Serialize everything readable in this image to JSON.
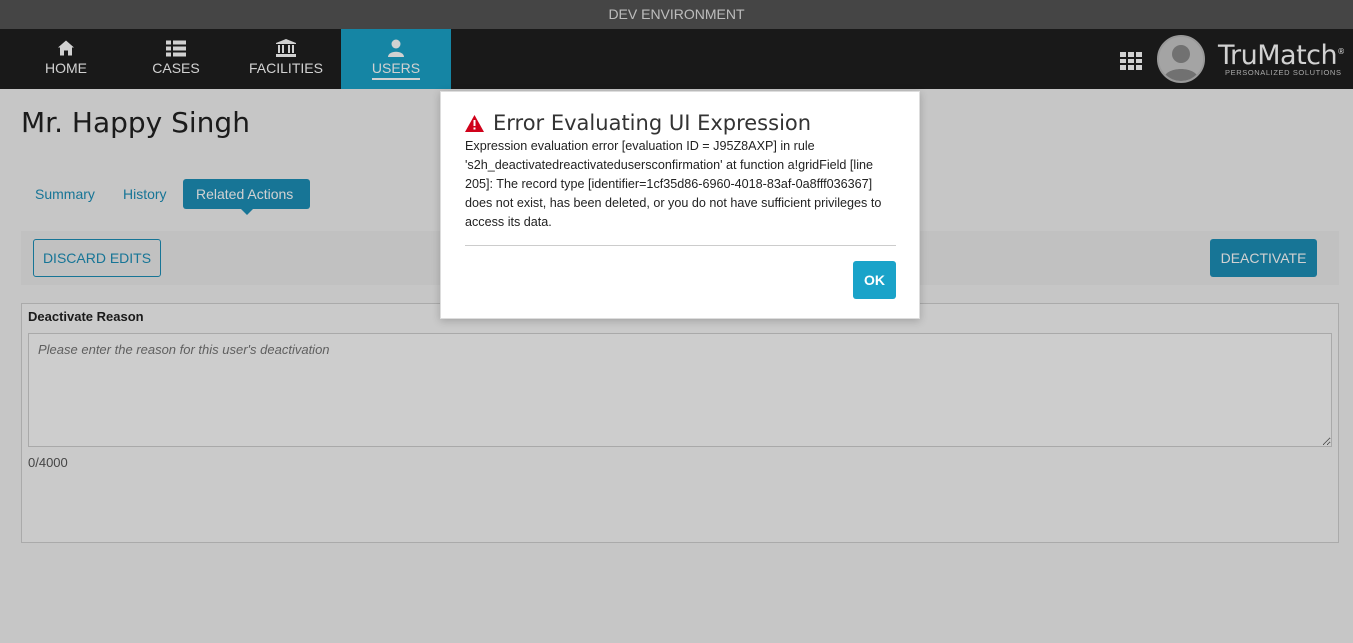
{
  "env_banner": "DEV ENVIRONMENT",
  "nav": {
    "items": [
      {
        "label": "HOME",
        "icon": "home-icon"
      },
      {
        "label": "CASES",
        "icon": "list-icon"
      },
      {
        "label": "FACILITIES",
        "icon": "bank-icon"
      },
      {
        "label": "USERS",
        "icon": "user-icon",
        "active": true
      }
    ],
    "brand_name": "TruMatch",
    "brand_reg": "®",
    "brand_tagline": "PERSONALIZED SOLUTIONS"
  },
  "page": {
    "title": "Mr. Happy Singh",
    "tabs": [
      "Summary",
      "History",
      "Related Actions"
    ],
    "active_tab": "Related Actions",
    "discard_label": "DISCARD EDITS",
    "deactivate_label": "DEACTIVATE",
    "form": {
      "reason_label": "Deactivate Reason",
      "reason_placeholder": "Please enter the reason for this user's deactivation",
      "reason_value": "",
      "char_count": "0/4000"
    }
  },
  "dialog": {
    "title": "Error Evaluating UI Expression",
    "message": "Expression evaluation error [evaluation ID = J95Z8AXP] in rule 's2h_deactivatedreactivatedusersconfirmation' at function a!gridField [line 205]: The record type [identifier=1cf35d86-6960-4018-83af-0a8fff036367] does not exist, has been deleted, or you do not have sufficient privileges to access its data.",
    "ok_label": "OK"
  },
  "colors": {
    "accent": "#1d8fb8",
    "nav_active": "#1aa3c9",
    "error_icon": "#d0021b"
  }
}
